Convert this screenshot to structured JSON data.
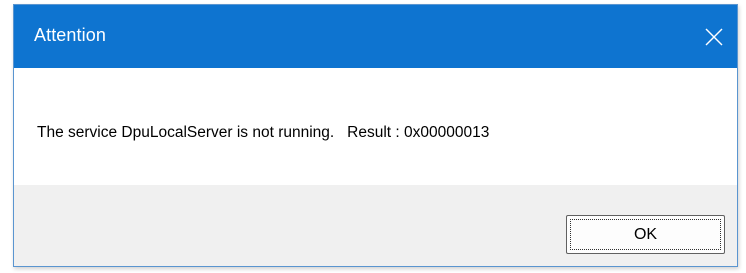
{
  "dialog": {
    "title": "Attention",
    "message": "The service DpuLocalServer is not running.   Result : 0x00000013",
    "ok_label": "OK",
    "close_icon": "close-icon"
  },
  "colors": {
    "titlebar": "#0e74d0",
    "title_text": "#ffffff",
    "body_background": "#ffffff",
    "footer_background": "#f0f0f0"
  }
}
